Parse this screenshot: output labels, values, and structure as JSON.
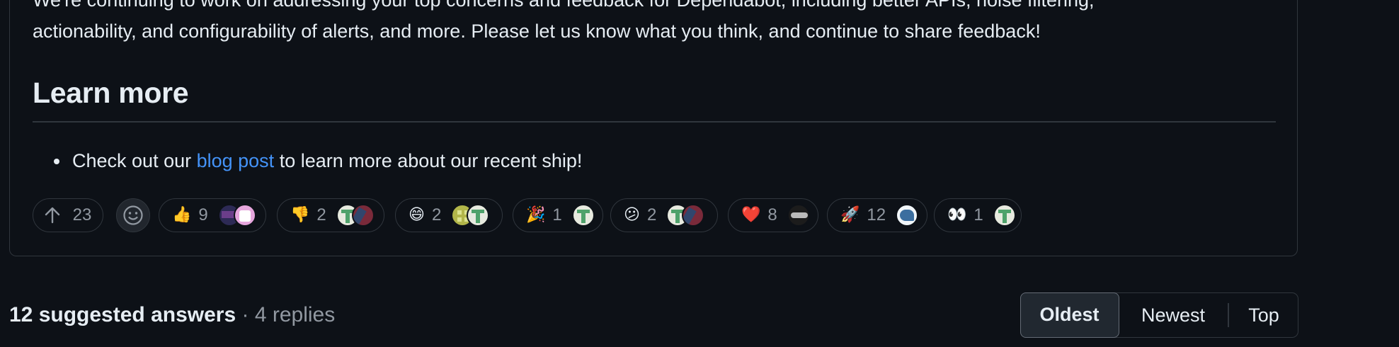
{
  "post": {
    "continuing_line1": "We're continuing to work on addressing your top concerns and feedback for Dependabot, including better APIs, noise filtering,",
    "continuing_line2": "actionability, and configurability of alerts, and more. Please let us know what you think, and continue to share feedback!",
    "learn_more_heading": "Learn more",
    "bullet_prefix": "Check out our ",
    "bullet_link": "blog post",
    "bullet_suffix": " to learn more about our recent ship!"
  },
  "reactions": {
    "upvote_count": "23",
    "items": [
      {
        "name": "thumbs-up",
        "emoji": "👍",
        "count": "9"
      },
      {
        "name": "thumbs-down",
        "emoji": "👎",
        "count": "2"
      },
      {
        "name": "laugh",
        "emoji": "😄",
        "count": "2"
      },
      {
        "name": "hooray",
        "emoji": "🎉",
        "count": "1"
      },
      {
        "name": "confused",
        "emoji": "😕",
        "count": "2"
      },
      {
        "name": "heart",
        "emoji": "❤️",
        "count": "8"
      },
      {
        "name": "rocket",
        "emoji": "🚀",
        "count": "12"
      },
      {
        "name": "eyes",
        "emoji": "👀",
        "count": "1"
      }
    ]
  },
  "footer": {
    "suggested_answers": "12 suggested answers",
    "separator": " · ",
    "replies": "4 replies"
  },
  "sort": {
    "oldest": "Oldest",
    "newest": "Newest",
    "top": "Top",
    "active": "Oldest"
  },
  "colors": {
    "background": "#0d1117",
    "border": "#30363d",
    "text": "#e6edf3",
    "muted": "#9198a1",
    "link": "#4493f8"
  }
}
